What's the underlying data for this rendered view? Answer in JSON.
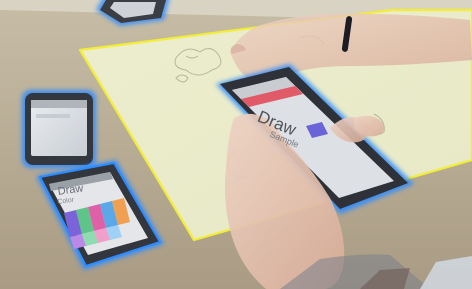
{
  "photo": {
    "description_tags": [
      "tabletop",
      "projected-surface",
      "smartphones",
      "hands"
    ],
    "colors": {
      "table": "#b4a88f",
      "projection": "#e8ebc8",
      "projection_border": "#f3ee35",
      "phone_glow": "#2d8cff",
      "phone_body": "#2c2f35",
      "phone_screen": "#d7dbe0",
      "skin": "#e7c6b4",
      "app_header": "#e05a68",
      "sample_swatch": "#6a64d8"
    }
  },
  "main_phone": {
    "screen_title": "Draw",
    "screen_subtitle": "Sample"
  },
  "left_phone_bottom": {
    "screen_title": "Draw",
    "screen_subtitle": "Color"
  }
}
